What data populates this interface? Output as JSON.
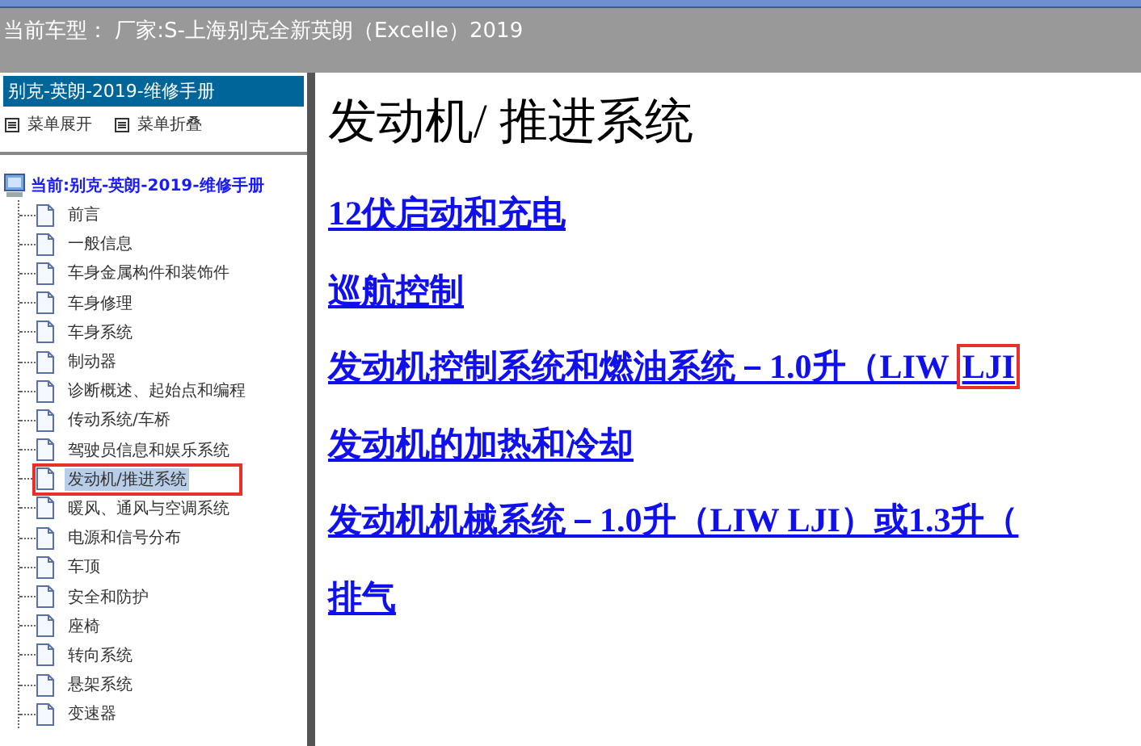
{
  "header": {
    "text": "当前车型：  厂家:S-上海别克全新英朗（Excelle）2019"
  },
  "sidebar": {
    "title": "别克-英朗-2019-维修手册",
    "menu_buttons": [
      {
        "label": "菜单展开"
      },
      {
        "label": "菜单折叠"
      }
    ],
    "tree": {
      "label": "当前:别克-英朗-2019-维修手册",
      "children": [
        {
          "label": "前言",
          "selected": false,
          "boxed": false
        },
        {
          "label": "一般信息",
          "selected": false,
          "boxed": false
        },
        {
          "label": "车身金属构件和装饰件",
          "selected": false,
          "boxed": false
        },
        {
          "label": "车身修理",
          "selected": false,
          "boxed": false
        },
        {
          "label": "车身系统",
          "selected": false,
          "boxed": false
        },
        {
          "label": "制动器",
          "selected": false,
          "boxed": false
        },
        {
          "label": "诊断概述、起始点和编程",
          "selected": false,
          "boxed": false
        },
        {
          "label": "传动系统/车桥",
          "selected": false,
          "boxed": false
        },
        {
          "label": "驾驶员信息和娱乐系统",
          "selected": false,
          "boxed": false
        },
        {
          "label": "发动机/推进系统",
          "selected": true,
          "boxed": true
        },
        {
          "label": "暖风、通风与空调系统",
          "selected": false,
          "boxed": false
        },
        {
          "label": "电源和信号分布",
          "selected": false,
          "boxed": false
        },
        {
          "label": "车顶",
          "selected": false,
          "boxed": false
        },
        {
          "label": "安全和防护",
          "selected": false,
          "boxed": false
        },
        {
          "label": "座椅",
          "selected": false,
          "boxed": false
        },
        {
          "label": "转向系统",
          "selected": false,
          "boxed": false
        },
        {
          "label": "悬架系统",
          "selected": false,
          "boxed": false
        },
        {
          "label": "变速器",
          "selected": false,
          "boxed": false
        }
      ]
    }
  },
  "content": {
    "title": "发动机/ 推进系统",
    "links": [
      {
        "text": "12伏启动和充电"
      },
      {
        "text": "巡航控制"
      },
      {
        "text": "发动机控制系统和燃油系统－1.0升（LIW ",
        "boxed_text": "LJI"
      },
      {
        "text": "发动机的加热和冷却"
      },
      {
        "text": "发动机机械系统－1.0升（LIW LJI）或1.3升（"
      },
      {
        "text": "排气"
      }
    ]
  }
}
